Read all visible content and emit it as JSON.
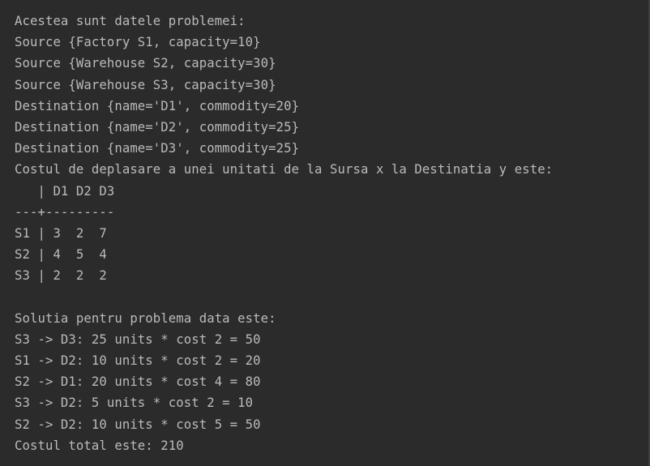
{
  "console": {
    "lines": [
      "Acestea sunt datele problemei:",
      "Source {Factory S1, capacity=10}",
      "Source {Warehouse S2, capacity=30}",
      "Source {Warehouse S3, capacity=30}",
      "Destination {name='D1', commodity=20}",
      "Destination {name='D2', commodity=25}",
      "Destination {name='D3', commodity=25}",
      "Costul de deplasare a unei unitati de la Sursa x la Destinatia y este:",
      "   | D1 D2 D3",
      "---+---------",
      "S1 | 3  2  7",
      "S2 | 4  5  4",
      "S3 | 2  2  2",
      "",
      "Solutia pentru problema data este:",
      "S3 -> D3: 25 units * cost 2 = 50",
      "S1 -> D2: 10 units * cost 2 = 20",
      "S2 -> D1: 20 units * cost 4 = 80",
      "S3 -> D2: 5 units * cost 2 = 10",
      "S2 -> D2: 10 units * cost 5 = 50",
      "Costul total este: 210"
    ]
  },
  "colors": {
    "background": "#2b2b2b",
    "text": "#bbbbbb"
  }
}
